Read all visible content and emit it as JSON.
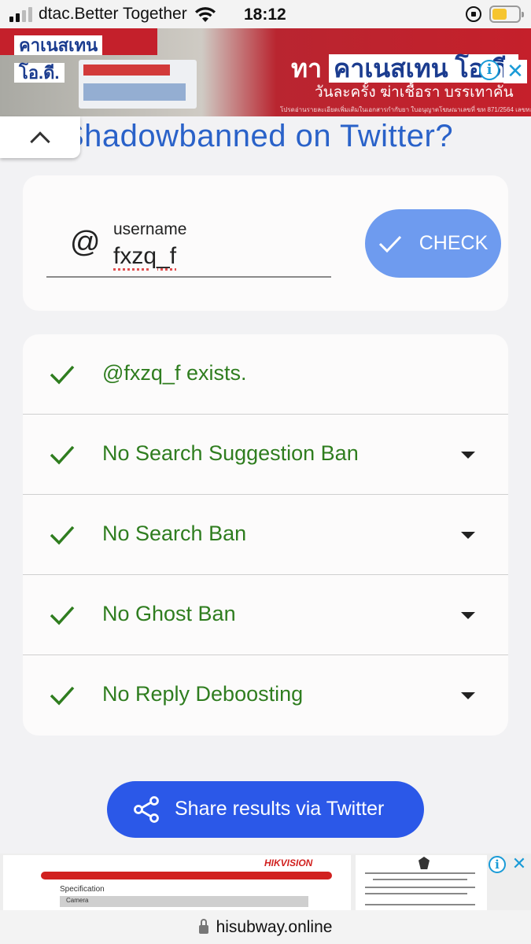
{
  "status_bar": {
    "carrier": "dtac.Better Together",
    "time": "18:12",
    "battery_color": "#f6c530"
  },
  "top_ad": {
    "brand_text": "คาเนสเทน",
    "brand_badge": "โอ.ดี.",
    "headline_prefix": "ทา",
    "headline_highlight": "คาเนสเทน โอ.ดี.",
    "subline": "วันละครั้ง ฆ่าเชื้อรา บรรเทาคัน",
    "fine_print": "โปรดอ่านรายละเอียดเพิ่มเติมในเอกสารกำกับยา  ใบอนุญาตโฆษณาเลขที่ ฆท 871/2564  เลขทะเบียนตำรับยาที่ 1C 79/54",
    "info_icon": "info-icon",
    "close_icon": "close-icon"
  },
  "page": {
    "title": "Shadowbanned on Twitter?",
    "collapse_icon": "chevron-up-icon"
  },
  "search": {
    "at_symbol": "@",
    "label": "username",
    "value": "fxzq_f",
    "check_label": "CHECK",
    "check_button_color": "#6e9bef"
  },
  "results": [
    {
      "text": "@fxzq_f exists.",
      "expandable": false
    },
    {
      "text": "No Search Suggestion Ban",
      "expandable": true
    },
    {
      "text": "No Search Ban",
      "expandable": true
    },
    {
      "text": "No Ghost Ban",
      "expandable": true
    },
    {
      "text": "No Reply Deboosting",
      "expandable": true
    }
  ],
  "result_color": "#2f7d1f",
  "share": {
    "label": "Share results via Twitter",
    "color": "#2b58e8"
  },
  "bottom_ad": {
    "brand": "HIKVISION",
    "spec_title": "Specification",
    "spec_row": "Camera"
  },
  "url_bar": {
    "domain": "hisubway.online"
  }
}
